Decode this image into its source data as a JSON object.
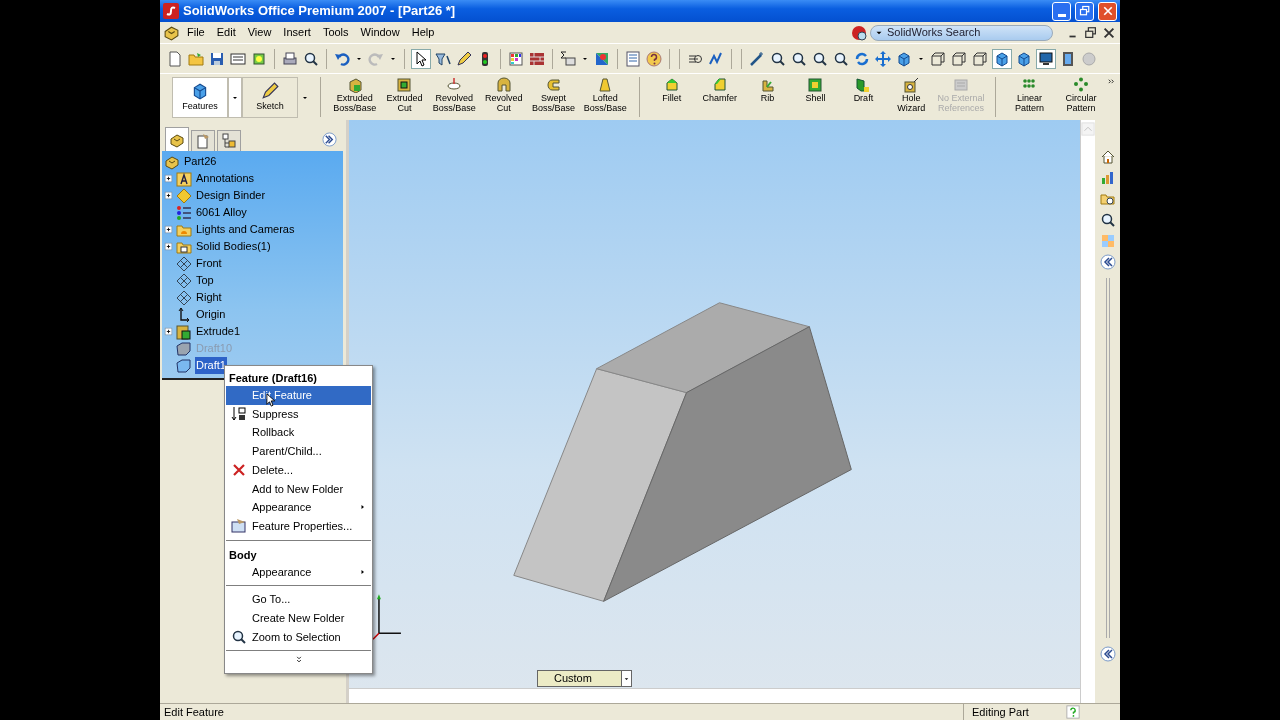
{
  "window": {
    "title": "SolidWorks Office Premium 2007 - [Part26 *]"
  },
  "menu_bar": [
    "File",
    "Edit",
    "View",
    "Insert",
    "Tools",
    "Window",
    "Help"
  ],
  "search": {
    "placeholder": "SolidWorks Search"
  },
  "command_manager": {
    "tabs": [
      {
        "label": "Features",
        "selected": true
      },
      {
        "label": "Sketch",
        "selected": false
      }
    ],
    "button_groups": [
      [
        {
          "label": "Extruded\nBoss/Base",
          "disabled": false
        },
        {
          "label": "Extruded\nCut",
          "disabled": false
        },
        {
          "label": "Revolved\nBoss/Base",
          "disabled": false
        },
        {
          "label": "Revolved\nCut",
          "disabled": false
        },
        {
          "label": "Swept\nBoss/Base",
          "disabled": false
        },
        {
          "label": "Lofted\nBoss/Base",
          "disabled": false
        }
      ],
      [
        {
          "label": "Fillet",
          "disabled": false
        },
        {
          "label": "Chamfer",
          "disabled": false
        },
        {
          "label": "Rib",
          "disabled": false
        },
        {
          "label": "Shell",
          "disabled": false
        },
        {
          "label": "Draft",
          "disabled": false
        },
        {
          "label": "Hole Wizard",
          "disabled": false
        },
        {
          "label": "No External\nReferences",
          "disabled": true
        }
      ],
      [
        {
          "label": "Linear\nPattern",
          "disabled": false
        },
        {
          "label": "Circular\nPattern",
          "disabled": false
        }
      ]
    ]
  },
  "feature_tree": {
    "panel_tabs": [
      {
        "selected": true
      },
      {
        "selected": false
      },
      {
        "selected": false
      }
    ],
    "root": "Part26",
    "items": [
      {
        "label": "Annotations",
        "kind": "annotations",
        "expandable": true,
        "suppressed": false,
        "selected": false
      },
      {
        "label": "Design Binder",
        "kind": "binder",
        "expandable": true,
        "suppressed": false,
        "selected": false
      },
      {
        "label": "6061 Alloy",
        "kind": "material",
        "expandable": false,
        "suppressed": false,
        "selected": false
      },
      {
        "label": "Lights and Cameras",
        "kind": "lights",
        "expandable": true,
        "suppressed": false,
        "selected": false
      },
      {
        "label": "Solid Bodies(1)",
        "kind": "bodies",
        "expandable": true,
        "suppressed": false,
        "selected": false
      },
      {
        "label": "Front",
        "kind": "plane",
        "expandable": false,
        "suppressed": false,
        "selected": false
      },
      {
        "label": "Top",
        "kind": "plane",
        "expandable": false,
        "suppressed": false,
        "selected": false
      },
      {
        "label": "Right",
        "kind": "plane",
        "expandable": false,
        "suppressed": false,
        "selected": false
      },
      {
        "label": "Origin",
        "kind": "origin",
        "expandable": false,
        "suppressed": false,
        "selected": false
      },
      {
        "label": "Extrude1",
        "kind": "extrude",
        "expandable": true,
        "suppressed": false,
        "selected": false
      },
      {
        "label": "Draft10",
        "kind": "draft",
        "expandable": false,
        "suppressed": true,
        "selected": false
      },
      {
        "label": "Draft1",
        "kind": "draft",
        "expandable": false,
        "suppressed": false,
        "selected": true
      }
    ]
  },
  "context_menu": {
    "sections": [
      {
        "title": "Feature (Draft16)",
        "items": [
          {
            "label": "Edit Feature",
            "kind": "plain",
            "selected": true,
            "submenu": false
          },
          {
            "label": "Suppress",
            "kind": "suppress",
            "selected": false,
            "submenu": false
          },
          {
            "label": "Rollback",
            "kind": "plain",
            "selected": false,
            "submenu": false
          },
          {
            "label": "Parent/Child...",
            "kind": "plain",
            "selected": false,
            "submenu": false
          },
          {
            "label": "Delete...",
            "kind": "delete",
            "selected": false,
            "submenu": false
          },
          {
            "label": "Add to New Folder",
            "kind": "plain",
            "selected": false,
            "submenu": false
          },
          {
            "label": "Appearance",
            "kind": "plain",
            "selected": false,
            "submenu": true
          },
          {
            "label": "Feature Properties...",
            "kind": "properties",
            "selected": false,
            "submenu": false
          }
        ]
      },
      {
        "title": "Body",
        "items": [
          {
            "label": "Appearance",
            "kind": "plain",
            "selected": false,
            "submenu": true
          }
        ]
      },
      {
        "items": [
          {
            "label": "Go To...",
            "kind": "plain",
            "selected": false,
            "submenu": false
          },
          {
            "label": "Create New Folder",
            "kind": "plain",
            "selected": false,
            "submenu": false
          },
          {
            "label": "Zoom to Selection",
            "kind": "zoom",
            "selected": false,
            "submenu": false
          }
        ]
      }
    ]
  },
  "view": {
    "display_state": "Custom"
  },
  "status_bar": {
    "message": "Edit Feature",
    "mode": "Editing Part"
  }
}
